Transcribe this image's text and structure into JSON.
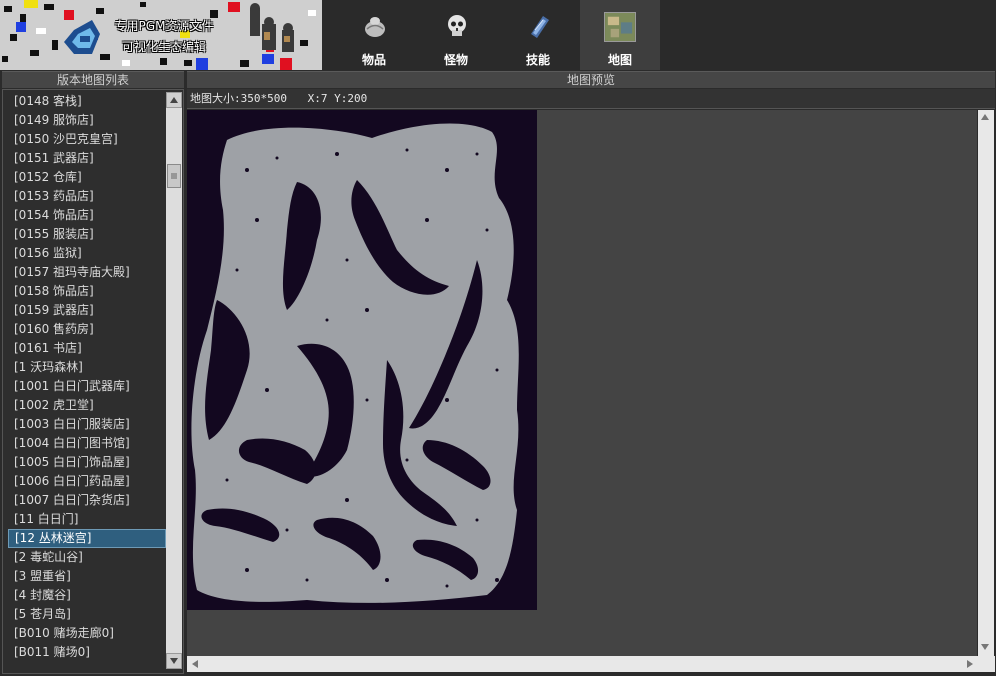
{
  "banner": {
    "line1": "专用PGM资源文件",
    "line2": "可视化生态编辑"
  },
  "tabs": [
    {
      "label": "物品",
      "icon": "item-bag-icon",
      "active": false
    },
    {
      "label": "怪物",
      "icon": "skull-icon",
      "active": false
    },
    {
      "label": "技能",
      "icon": "skill-book-icon",
      "active": false
    },
    {
      "label": "地图",
      "icon": "map-thumbnail-icon",
      "active": true
    }
  ],
  "left_panel": {
    "title": "版本地图列表",
    "selected_index": 23,
    "items": [
      "[0148 客栈]",
      "[0149 服饰店]",
      "[0150 沙巴克皇宫]",
      "[0151 武器店]",
      "[0152 仓库]",
      "[0153 药品店]",
      "[0154 饰品店]",
      "[0155 服装店]",
      "[0156 监狱]",
      "[0157 祖玛寺庙大殿]",
      "[0158 饰品店]",
      "[0159 武器店]",
      "[0160 售药房]",
      "[0161 书店]",
      "[1 沃玛森林]",
      "[1001 白日门武器库]",
      "[1002 虎卫堂]",
      "[1003 白日门服装店]",
      "[1004 白日门图书馆]",
      "[1005 白日门饰品屋]",
      "[1006 白日门药品屋]",
      "[1007 白日门杂货店]",
      "[11 白日门]",
      "[12 丛林迷宫]",
      "[2 毒蛇山谷]",
      "[3 盟重省]",
      "[4 封魔谷]",
      "[5 苍月岛]",
      "[B010 赌场走廊0]",
      "[B011 赌场0]"
    ]
  },
  "right_panel": {
    "title": "地图预览",
    "map_size": "地图大小:350*500",
    "coords": "X:7 Y:200"
  },
  "colors": {
    "map_floor": "#9ea1a6",
    "map_void": "#130820",
    "selection": "#2f5f7f",
    "panel_header": "#464646"
  }
}
